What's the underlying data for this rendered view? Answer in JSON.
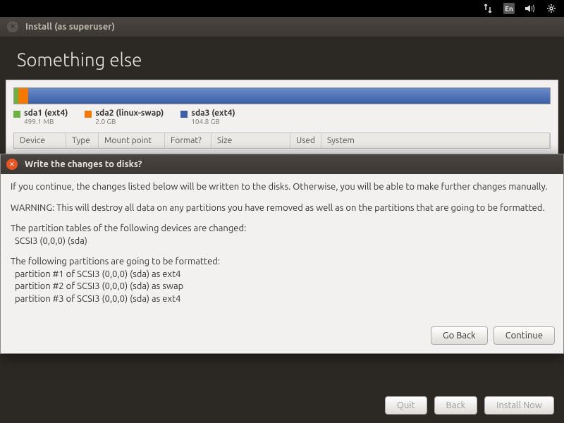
{
  "topbar": {
    "lang": "En"
  },
  "window": {
    "title": "Install (as superuser)"
  },
  "heading": "Something else",
  "partitions": [
    {
      "name": "sda1 (ext4)",
      "size": "499.1 MB",
      "color": "g"
    },
    {
      "name": "sda2 (linux-swap)",
      "size": "2.0 GB",
      "color": "o"
    },
    {
      "name": "sda3 (ext4)",
      "size": "104.8 GB",
      "color": "b"
    }
  ],
  "columns": {
    "device": "Device",
    "type": "Type",
    "mount": "Mount point",
    "format": "Format?",
    "size": "Size",
    "used": "Used",
    "system": "System"
  },
  "dialog": {
    "title": "Write the changes to disks?",
    "intro": "If you continue, the changes listed below will be written to the disks. Otherwise, you will be able to make further changes manually.",
    "warning": "WARNING: This will destroy all data on any partitions you have removed as well as on the partitions that are going to be formatted.",
    "tables_label": "The partition tables of the following devices are changed:",
    "tables_item": "SCSI3 (0,0,0) (sda)",
    "format_label": "The following partitions are going to be formatted:",
    "format_items": [
      "partition #1 of SCSI3 (0,0,0) (sda) as ext4",
      "partition #2 of SCSI3 (0,0,0) (sda) as swap",
      "partition #3 of SCSI3 (0,0,0) (sda) as ext4"
    ],
    "go_back": "Go Back",
    "continue": "Continue"
  },
  "footer": {
    "quit": "Quit",
    "back": "Back",
    "install": "Install Now"
  }
}
